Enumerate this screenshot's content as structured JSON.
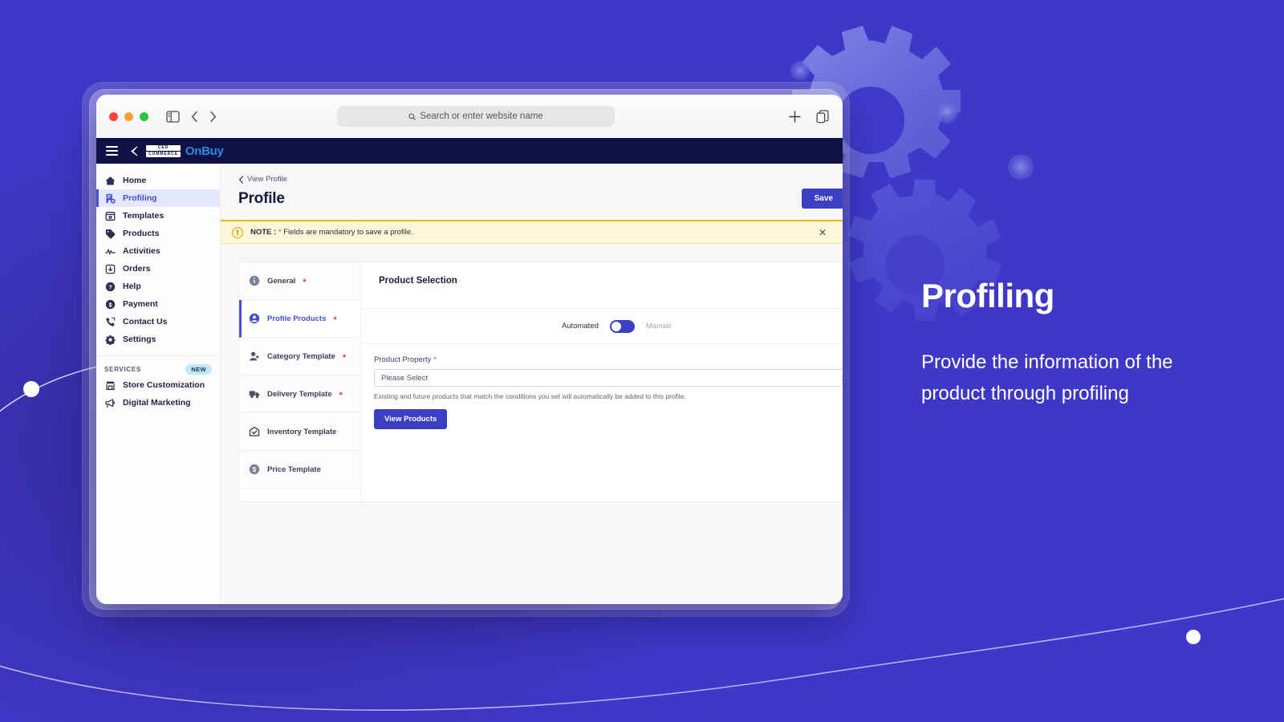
{
  "browser": {
    "traffic_lights": [
      "close",
      "minimize",
      "maximize"
    ],
    "sidebar_toggle_icon": "sidebar-toggle-icon",
    "back_icon": "chevron-left-icon",
    "forward_icon": "chevron-right-icon",
    "omnibox_placeholder": "Search or enter website name",
    "omnibox_search_icon": "search-icon",
    "new_tab_icon": "plus-icon",
    "tab_overview_icon": "copy-tabs-icon"
  },
  "app_header": {
    "menu_icon": "hamburger-menu-icon",
    "logo_mark": "ced-logo-icon",
    "badge_line1": "CED",
    "badge_line2": "COMMERCE",
    "brand": "OnBuy"
  },
  "sidebar": {
    "items": [
      {
        "label": "Home",
        "icon": "home-icon",
        "active": false
      },
      {
        "label": "Profiling",
        "icon": "profiling-icon",
        "active": true
      },
      {
        "label": "Templates",
        "icon": "templates-icon",
        "active": false
      },
      {
        "label": "Products",
        "icon": "tag-icon",
        "active": false
      },
      {
        "label": "Activities",
        "icon": "activity-pulse-icon",
        "active": false
      },
      {
        "label": "Orders",
        "icon": "orders-inbox-icon",
        "active": false
      },
      {
        "label": "Help",
        "icon": "help-circle-icon",
        "active": false
      },
      {
        "label": "Payment",
        "icon": "dollar-circle-icon",
        "active": false
      },
      {
        "label": "Contact Us",
        "icon": "phone-icon",
        "active": false
      },
      {
        "label": "Settings",
        "icon": "gear-icon",
        "active": false
      }
    ],
    "services_title": "SERVICES",
    "services_badge": "NEW",
    "services": [
      {
        "label": "Store Customization",
        "icon": "storefront-icon"
      },
      {
        "label": "Digital Marketing",
        "icon": "megaphone-icon"
      }
    ]
  },
  "main": {
    "breadcrumb": "View Profile",
    "breadcrumb_icon": "chevron-left-icon",
    "page_title": "Profile",
    "save_label": "Save",
    "note": {
      "icon": "alert-circle-icon",
      "label": "NOTE :",
      "asterisk": "*",
      "text": "Fields are mandatory to save a profile.",
      "close_icon": "close-icon"
    },
    "tabs": [
      {
        "label": "General",
        "icon": "info-circle-icon",
        "required": true,
        "active": false
      },
      {
        "label": "Profile Products",
        "icon": "user-circle-icon",
        "required": true,
        "active": true
      },
      {
        "label": "Category Template",
        "icon": "user-plus-icon",
        "required": true,
        "active": false
      },
      {
        "label": "Delivery Template",
        "icon": "truck-icon",
        "required": true,
        "active": false
      },
      {
        "label": "Inventory Template",
        "icon": "inventory-box-icon",
        "required": false,
        "active": false
      },
      {
        "label": "Price Template",
        "icon": "dollar-circle-icon",
        "required": false,
        "active": false
      }
    ],
    "panel": {
      "title": "Product Selection",
      "toggle_left": "Automated",
      "toggle_right": "Manual",
      "toggle_state": "automated",
      "field_label": "Product Property",
      "field_required": "*",
      "select_value": "Please Select",
      "select_caret_icon": "select-stepper-icon",
      "helper_text": "Existing and future products that match the conditions you set will automatically be added to this profile.",
      "view_products_label": "View Products"
    }
  },
  "promo": {
    "heading": "Profiling",
    "body": "Provide the information of the product through profiling"
  },
  "colors": {
    "background_purple": "#3f37c8",
    "accent_blue": "#3b3fc4",
    "header_navy": "#101045",
    "note_yellow": "#fcf7d8",
    "note_border": "#e9b811",
    "required_red": "#e04242",
    "brand_blue": "#2f8be0",
    "new_badge_bg": "#bfe9f7"
  }
}
